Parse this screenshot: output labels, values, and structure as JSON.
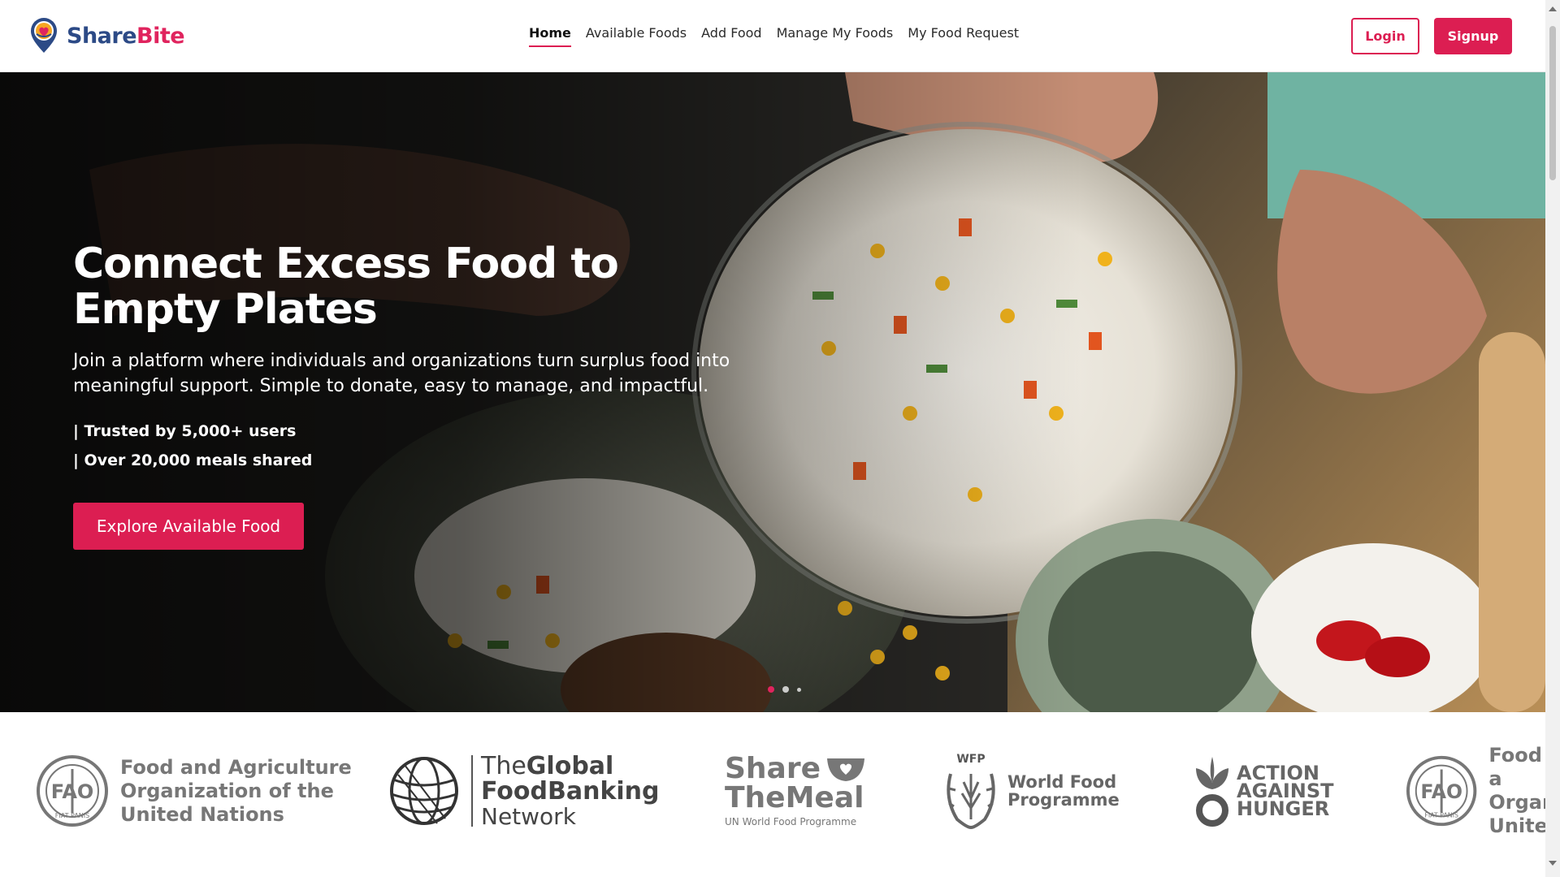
{
  "brand": {
    "part1": "Share",
    "part2": "Bite"
  },
  "nav": {
    "links": [
      {
        "label": "Home",
        "active": true
      },
      {
        "label": "Available Foods",
        "active": false
      },
      {
        "label": "Add Food",
        "active": false
      },
      {
        "label": "Manage My Foods",
        "active": false
      },
      {
        "label": "My Food Request",
        "active": false
      }
    ],
    "login_label": "Login",
    "signup_label": "Signup"
  },
  "hero": {
    "title_line1": "Connect Excess Food to",
    "title_line2": "Empty Plates",
    "subtitle": "Join a platform where individuals and organizations turn surplus food into meaningful support. Simple to donate, easy to manage, and impactful.",
    "stats": [
      "| Trusted by 5,000+ users",
      "| Over 20,000 meals shared"
    ],
    "cta_label": "Explore Available Food",
    "slide_count": 3,
    "active_slide": 1
  },
  "partners": {
    "fao": {
      "line1": "Food and Agriculture",
      "line2": "Organization of the",
      "line3": "United Nations",
      "emblem_letters": "FAO",
      "emblem_motto": "FIAT PANIS"
    },
    "gfn": {
      "line1a": "The",
      "line1b": "Global",
      "line2": "FoodBanking",
      "line3": "Network"
    },
    "stm": {
      "line1": "Share",
      "line2": "TheMeal",
      "sub": "UN World Food Programme"
    },
    "wfp": {
      "abbr": "WFP",
      "line1": "World Food",
      "line2": "Programme"
    },
    "aah": {
      "line1": "ACTION",
      "line2": "AGAINST",
      "line3": "HUNGER"
    },
    "fao2": {
      "line1": "Food a",
      "line2": "Organ",
      "line3": "Unitec"
    }
  },
  "colors": {
    "accent": "#dc1e52",
    "brand_blue": "#2c4a86",
    "partner_grey": "#777777"
  }
}
